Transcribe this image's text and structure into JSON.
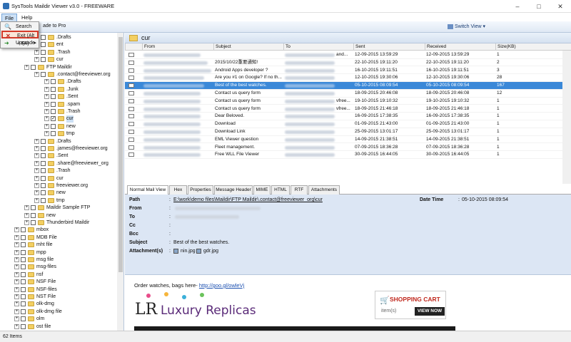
{
  "window": {
    "title": "SysTools Maildir Viewer v3.0 - FREEWARE"
  },
  "menu": {
    "file": "File",
    "help": "Help"
  },
  "file_menu": {
    "search": "Search",
    "exit": "Exit (Alt + F4)",
    "upgrade": "Upgrade"
  },
  "toolbar": {
    "upgrade_pro": "ade to Pro",
    "switch_view": "Switch View"
  },
  "tree": {
    "items": [
      {
        "label": ".Drafts",
        "level": 3
      },
      {
        "label": "ent",
        "level": 3
      },
      {
        "label": ".Trash",
        "level": 3
      },
      {
        "label": "cur",
        "level": 3
      },
      {
        "label": "FTP Maildir",
        "level": 2
      },
      {
        "label": ".contact@freeviewer.org",
        "level": 3
      },
      {
        "label": ".Drafts",
        "level": 4
      },
      {
        "label": ".Junk",
        "level": 4
      },
      {
        "label": ".Sent",
        "level": 4
      },
      {
        "label": ".spam",
        "level": 4
      },
      {
        "label": ".Trash",
        "level": 4
      },
      {
        "label": "cur",
        "level": 4,
        "checked": true
      },
      {
        "label": "new",
        "level": 4
      },
      {
        "label": "tmp",
        "level": 4
      },
      {
        "label": ".Drafts",
        "level": 3
      },
      {
        "label": ".james@freeviewer.org",
        "level": 3
      },
      {
        "label": ".Sent",
        "level": 3
      },
      {
        "label": ".share@freeviewer_org",
        "level": 3
      },
      {
        "label": ".Trash",
        "level": 3
      },
      {
        "label": "cur",
        "level": 3
      },
      {
        "label": "freeviewer.org",
        "level": 3
      },
      {
        "label": "new",
        "level": 3
      },
      {
        "label": "tmp",
        "level": 3
      },
      {
        "label": "Maildir Sample FTP",
        "level": 2
      },
      {
        "label": "new",
        "level": 2
      },
      {
        "label": "Thunderbird Maildir",
        "level": 2
      },
      {
        "label": "mbox",
        "level": 1
      },
      {
        "label": "MDB File",
        "level": 1
      },
      {
        "label": "mht file",
        "level": 1
      },
      {
        "label": "mpp",
        "level": 1
      },
      {
        "label": "msg file",
        "level": 1
      },
      {
        "label": "msg-files",
        "level": 1
      },
      {
        "label": "nsf",
        "level": 1
      },
      {
        "label": "NSF File",
        "level": 1
      },
      {
        "label": "NSF-files",
        "level": 1
      },
      {
        "label": "NST File",
        "level": 1
      },
      {
        "label": "olk-dmg",
        "level": 1
      },
      {
        "label": "olk-dmg file",
        "level": 1
      },
      {
        "label": "olm",
        "level": 1
      },
      {
        "label": "ost file",
        "level": 1
      }
    ]
  },
  "folder_header": {
    "title": "cur"
  },
  "grid": {
    "columns": [
      "From",
      "Subject",
      "To",
      "Sent",
      "Received",
      "Size(KB)"
    ],
    "rows": [
      {
        "subject": "",
        "to_tail": "and...",
        "sent": "12-09-2015 13:59:29",
        "received": "12-09-2015 13:59:29",
        "size": "1",
        "from_w": 80,
        "subject_w": 60
      },
      {
        "subject": "2015/10/22重要通知!",
        "to_tail": "",
        "sent": "22-10-2015 19:11:20",
        "received": "22-10-2015 19:11:20",
        "size": "2",
        "from_w": 90,
        "subject_w": 0
      },
      {
        "subject": "Android Apps developer ?",
        "to_tail": "",
        "sent": "16-10-2015 19:11:51",
        "received": "16-10-2015 19:11:51",
        "size": "3",
        "from_w": 95,
        "subject_w": 0
      },
      {
        "subject": "Are you #1 on Google? If no th...",
        "to_tail": "",
        "sent": "12-10-2015 19:30:06",
        "received": "12-10-2015 19:30:06",
        "size": "28",
        "from_w": 85,
        "subject_w": 0
      },
      {
        "subject": "Best of the best watches.",
        "to_tail": "",
        "sent": "05-10-2015 08:09:54",
        "received": "05-10-2015 08:09:54",
        "size": "167",
        "from_w": 85,
        "subject_w": 0,
        "selected": true
      },
      {
        "subject": "Contact us query form",
        "to_tail": "",
        "sent": "18-09-2015 20:46:08",
        "received": "18-09-2015 20:46:08",
        "size": "12",
        "from_w": 80,
        "subject_w": 0
      },
      {
        "subject": "Contact us query form",
        "to_tail": "vfree...",
        "sent": "19-10-2015 19:10:32",
        "received": "19-10-2015 19:10:32",
        "size": "1",
        "from_w": 80,
        "subject_w": 0
      },
      {
        "subject": "Contact us query form",
        "to_tail": "vfree...",
        "sent": "18-09-2015 21:46:18",
        "received": "18-09-2015 21:46:18",
        "size": "1",
        "from_w": 80,
        "subject_w": 0
      },
      {
        "subject": "Dear Beloved.",
        "to_tail": "",
        "sent": "16-09-2015 17:38:35",
        "received": "16-09-2015 17:38:35",
        "size": "1",
        "from_w": 80,
        "subject_w": 0
      },
      {
        "subject": "Download",
        "to_tail": "",
        "sent": "01-09-2015 21:43:00",
        "received": "01-09-2015 21:43:00",
        "size": "1",
        "from_w": 80,
        "subject_w": 0
      },
      {
        "subject": "Download Link",
        "to_tail": "",
        "sent": "25-09-2015 13:01:17",
        "received": "25-09-2015 13:01:17",
        "size": "1",
        "from_w": 80,
        "subject_w": 0
      },
      {
        "subject": "EML Viewer question",
        "to_tail": "",
        "sent": "14-09-2015 21:38:51",
        "received": "14-09-2015 21:38:51",
        "size": "1",
        "from_w": 80,
        "subject_w": 0
      },
      {
        "subject": "Fleet management.",
        "to_tail": "",
        "sent": "07-09-2015 18:36:28",
        "received": "07-09-2015 18:36:28",
        "size": "1",
        "from_w": 80,
        "subject_w": 0
      },
      {
        "subject": "Free WLL File Viewer",
        "to_tail": "",
        "sent": "30-09-2015 16:44:05",
        "received": "30-09-2015 16:44:05",
        "size": "1",
        "from_w": 80,
        "subject_w": 0
      }
    ]
  },
  "tabs": [
    "Normal Mail View",
    "Hex",
    "Properties",
    "Message Header",
    "MIME",
    "HTML",
    "RTF",
    "Attachments"
  ],
  "details": {
    "labels": {
      "path": "Path",
      "from": "From",
      "to": "To",
      "cc": "Cc",
      "bcc": "Bcc",
      "subject": "Subject",
      "attachments": "Attachment(s)",
      "datetime": "Date Time"
    },
    "path": "E:\\work\\demo files\\Maildir\\FTP Maildir\\.contact@freeviewer_org\\cur",
    "datetime": "05-10-2015 08:09:54",
    "subject": "Best of the best watches.",
    "attachments": [
      "nin.jpg",
      "gdr.jpg"
    ]
  },
  "body": {
    "text": "Order watches, bags here- ",
    "link": "http://goo.gl/owleVj",
    "logo_lr": "LR",
    "logo_name": "Luxury Replicas",
    "cart_title": "SHOPPING CART",
    "cart_items": "item(s)",
    "cart_button": "VIEW NOW"
  },
  "status": {
    "count": "62 Items"
  }
}
